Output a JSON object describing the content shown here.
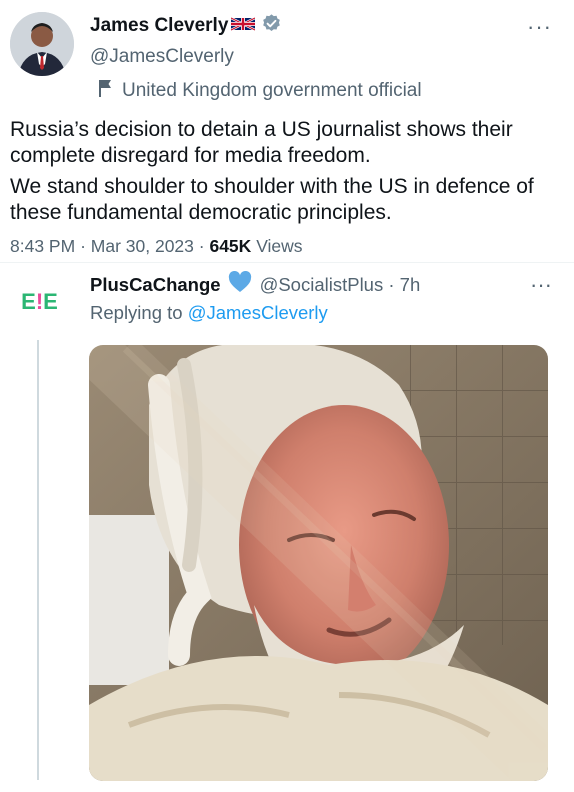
{
  "tweet": {
    "display_name": "James Cleverly",
    "handle": "@JamesCleverly",
    "gov_label": "United Kingdom government official",
    "paragraphs": [
      "Russia’s decision to detain a US journalist shows their complete disregard for media freedom.",
      "We stand shoulder to shoulder with the US in defence of these fundamental democratic principles."
    ],
    "time": "8:43 PM",
    "date": "Mar 30, 2023",
    "views_count": "645K",
    "views_label": "Views",
    "more": "···"
  },
  "reply": {
    "logo_text": "E!E",
    "display_name": "PlusCaChange",
    "handle": "@SocialistPlus",
    "age": "7h",
    "replying_prefix": "Replying to",
    "replying_to": "@JamesCleverly",
    "more": "···"
  },
  "colors": {
    "text": "#0f1419",
    "secondary": "#536471",
    "link": "#1d9bf0",
    "verified_badge": "#829aab",
    "divider": "#eff3f4",
    "logo_green": "#2bb673",
    "logo_pink": "#ec4c9c"
  },
  "icons": {
    "verified": "verified-badge-icon",
    "flag": "uk-flag-icon",
    "gov": "flag-icon",
    "heart": "blue-heart-icon",
    "more": "more-options-icon"
  }
}
